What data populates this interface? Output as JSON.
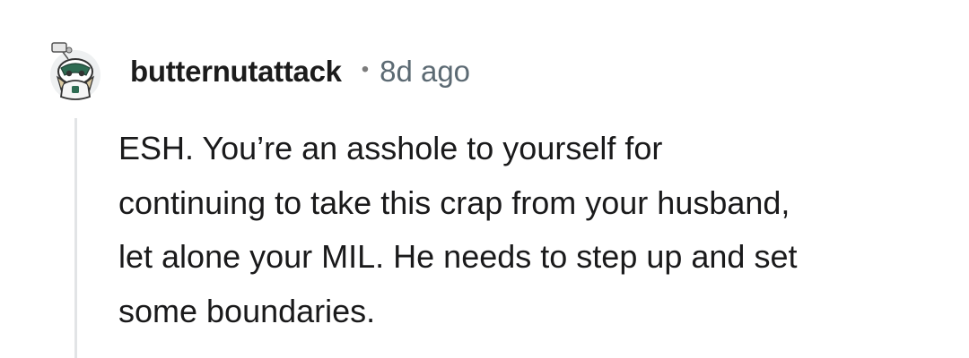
{
  "comment": {
    "author": "butternutattack",
    "separator": "•",
    "age": "8d ago",
    "body_lines": [
      "ESH. You’re an asshole to yourself for",
      "continuing to take this crap from your husband,",
      "let alone your MIL. He needs to step up and set",
      "some boundaries."
    ],
    "avatar_icon": "snoo-avatar-icon"
  },
  "colors": {
    "username": "#1c1c1c",
    "timestamp": "#5c6a73",
    "body": "#1a1a1b",
    "thread_line": "#e2e4e6",
    "avatar_accent": "#2e6b52"
  }
}
